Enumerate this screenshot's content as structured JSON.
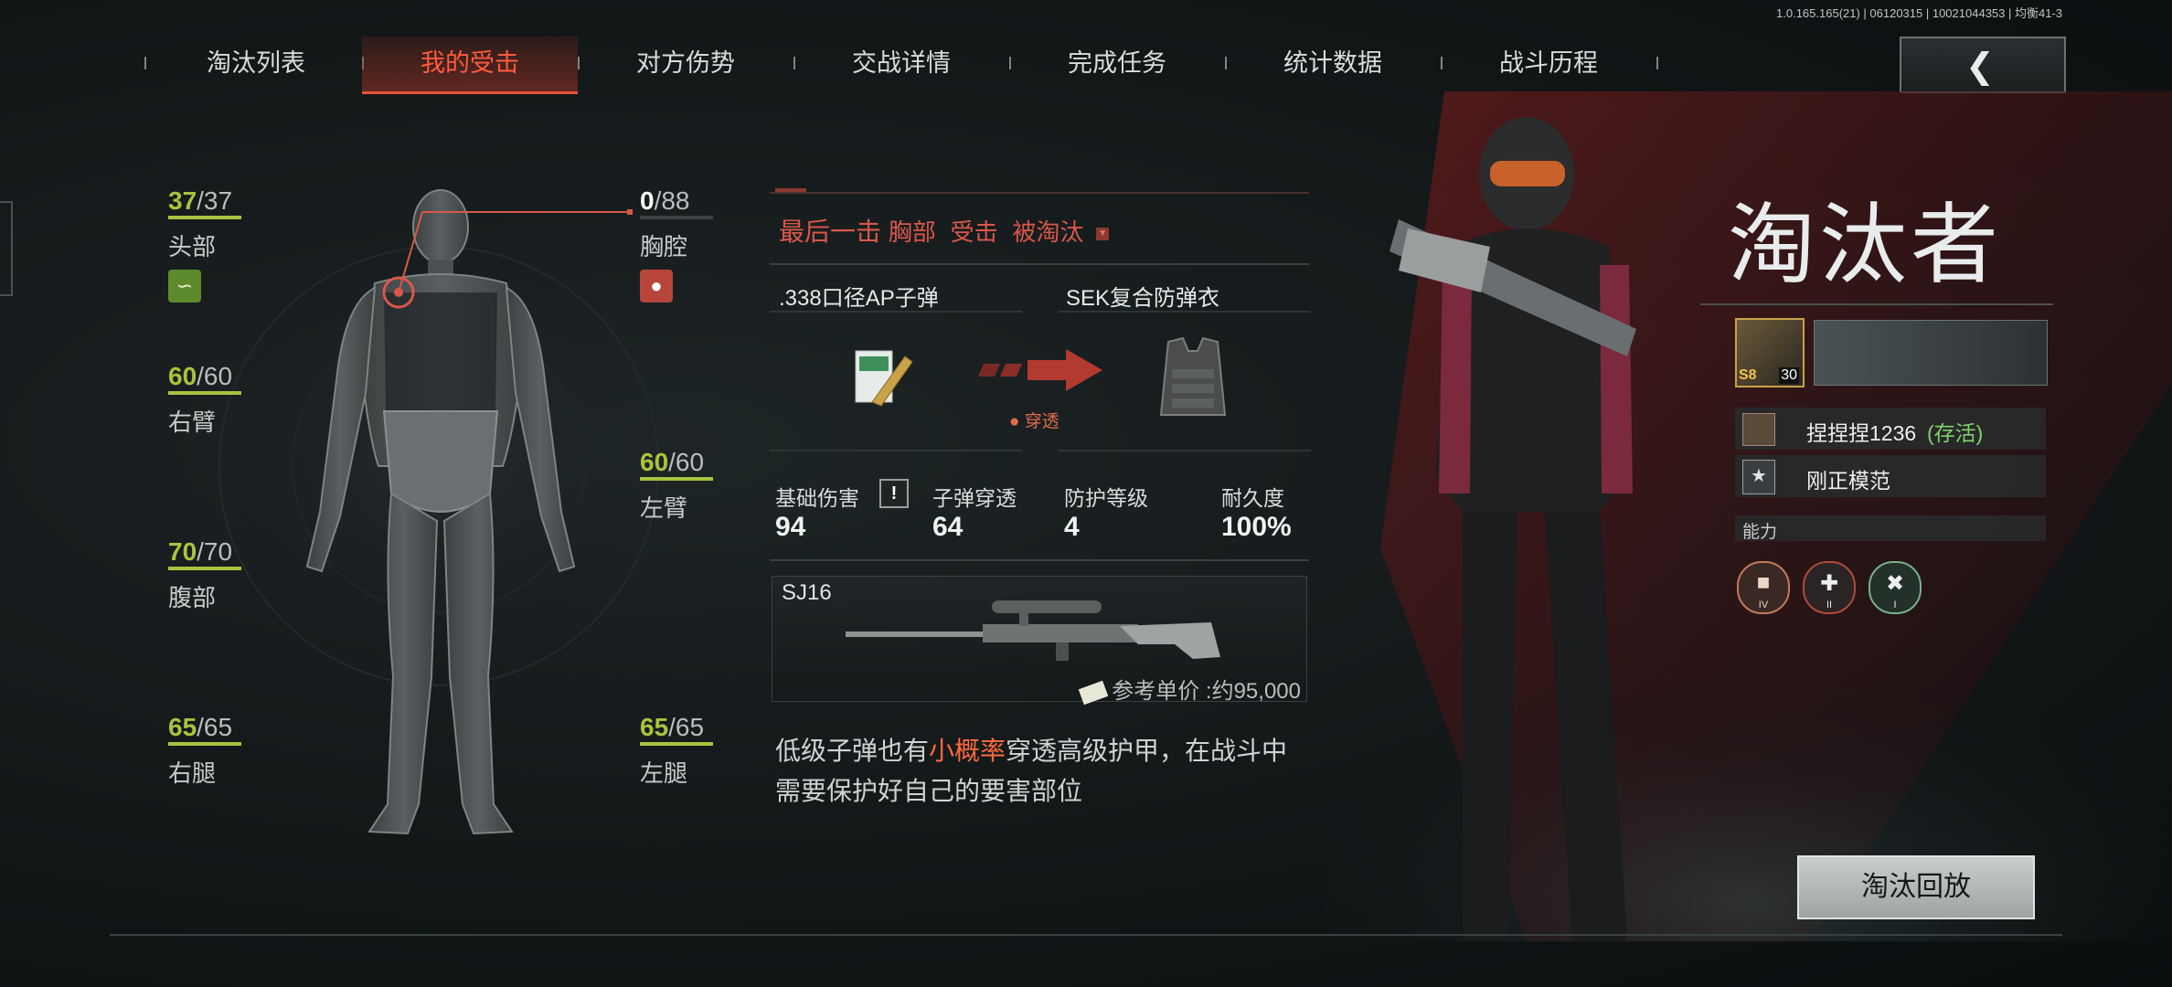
{
  "version": "1.0.165.165(21) | 06120315 | 10021044353 | 均衡41-3",
  "tabs": [
    "淘汰列表",
    "我的受击",
    "对方伤势",
    "交战详情",
    "完成任务",
    "统计数据",
    "战斗历程"
  ],
  "active_tab": "我的受击",
  "back_icon": "chevron-left-icon",
  "body_parts": {
    "head": {
      "cur": "37",
      "max": "/37",
      "label": "头部",
      "fill": 1.0
    },
    "chest": {
      "cur": "0",
      "max": "/88",
      "label": "胸腔",
      "fill": 0.0
    },
    "right_arm": {
      "cur": "60",
      "max": "/60",
      "label": "右臂",
      "fill": 1.0
    },
    "left_arm": {
      "cur": "60",
      "max": "/60",
      "label": "左臂",
      "fill": 1.0
    },
    "abdomen": {
      "cur": "70",
      "max": "/70",
      "label": "腹部",
      "fill": 1.0
    },
    "right_leg": {
      "cur": "65",
      "max": "/65",
      "label": "右腿",
      "fill": 1.0
    },
    "left_leg": {
      "cur": "65",
      "max": "/65",
      "label": "左腿",
      "fill": 1.0
    }
  },
  "hit": {
    "last_hit": "最后一击",
    "part": "胸部",
    "hit_word": "受击",
    "eliminated": "被淘汰",
    "ammo": ".338口径AP子弹",
    "armor": "SEK复合防弹衣",
    "penetrate": "穿透",
    "stats": [
      {
        "label": "基础伤害",
        "value": "94"
      },
      {
        "label": "子弹穿透",
        "value": "64"
      },
      {
        "label": "防护等级",
        "value": "4"
      },
      {
        "label": "耐久度",
        "value": "100%"
      }
    ],
    "weapon": "SJ16",
    "price": "参考单价 :约95,000",
    "tip_before": "低级子弹也有",
    "tip_highlight": "小概率",
    "tip_after": "穿透高级护甲，在战斗中",
    "tip_line2": "需要保护好自己的要害部位"
  },
  "eliminator": {
    "title": "淘汰者",
    "level": "30",
    "season_badge": "S8",
    "name": "捏捏捏1236",
    "status": "(存活)",
    "honor": "刚正模范",
    "ability_label": "能力",
    "ability_levels": [
      "IV",
      "II",
      "I"
    ],
    "replay_button": "淘汰回放"
  },
  "colors": {
    "accent": "#e8533a",
    "health": "#a7c43d",
    "kill": "#d8574a",
    "highlight": "#ff6a3d",
    "alive": "#7fd46a"
  }
}
